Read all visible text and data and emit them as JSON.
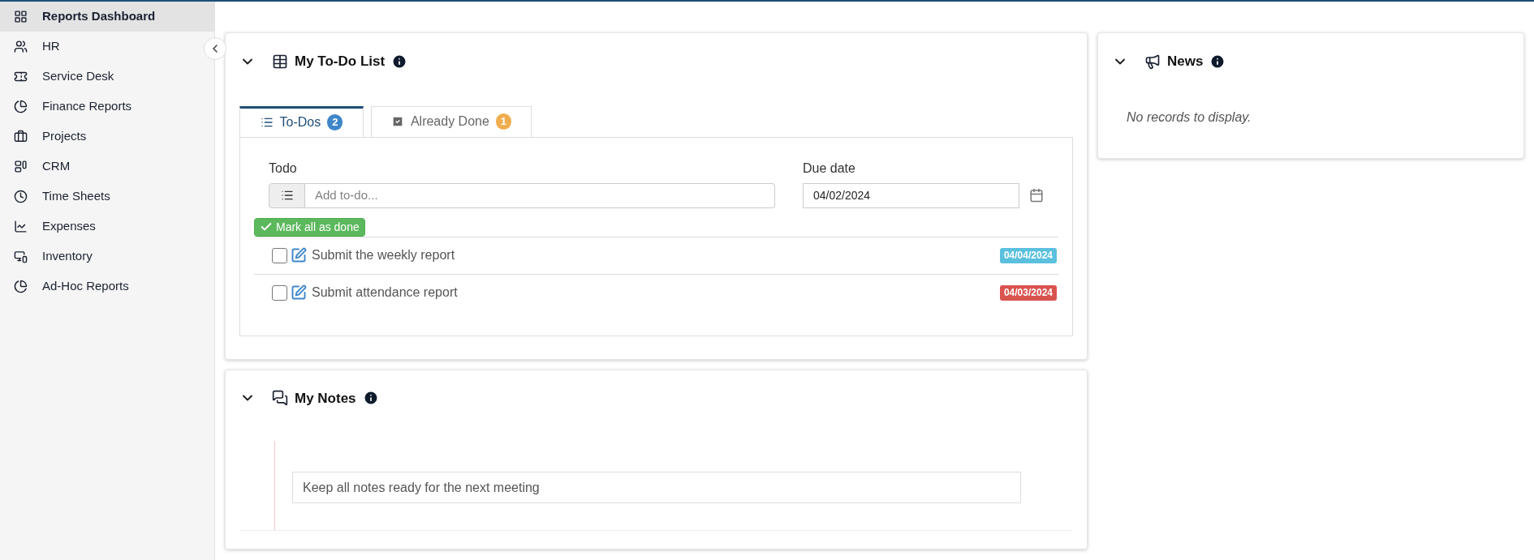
{
  "sidebar": {
    "items": [
      {
        "label": "Reports Dashboard",
        "selected": true
      },
      {
        "label": "HR",
        "selected": false
      },
      {
        "label": "Service Desk",
        "selected": false
      },
      {
        "label": "Finance Reports",
        "selected": false
      },
      {
        "label": "Projects",
        "selected": false
      },
      {
        "label": "CRM",
        "selected": false
      },
      {
        "label": "Time Sheets",
        "selected": false
      },
      {
        "label": "Expenses",
        "selected": false
      },
      {
        "label": "Inventory",
        "selected": false
      },
      {
        "label": "Ad-Hoc Reports",
        "selected": false
      }
    ]
  },
  "todo_card": {
    "title": "My To-Do List",
    "expanded": true,
    "tabs": [
      {
        "label": "To-Dos",
        "count": "2",
        "color": "#3f86c9",
        "selected": true
      },
      {
        "label": "Already Done",
        "count": "1",
        "color": "#f0ad4e",
        "selected": false
      }
    ],
    "todo_label": "Todo",
    "todo_placeholder": "Add to-do...",
    "due_label": "Due date",
    "due_value": "04/02/2024",
    "mark_all_button": "Mark all as done",
    "items": [
      {
        "text": "Submit the weekly report",
        "checked": false,
        "due": "04/04/2024",
        "color": "#5bc0de"
      },
      {
        "text": "Submit attendance report",
        "checked": false,
        "due": "04/03/2024",
        "color": "#d9534f"
      }
    ]
  },
  "notes_card": {
    "title": "My Notes",
    "expanded": true,
    "note": "Keep all notes ready for the next meeting"
  },
  "news_card": {
    "title": "News",
    "expanded": true,
    "empty_text": "No records to display."
  }
}
